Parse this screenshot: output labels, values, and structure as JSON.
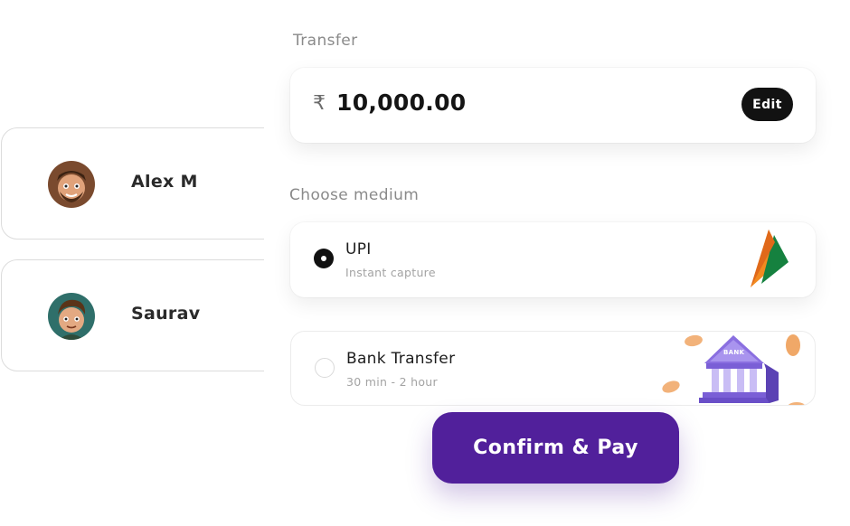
{
  "contacts": [
    {
      "name": "Alex M",
      "avatar_icon": "person-avatar-icon"
    },
    {
      "name": "Saurav",
      "avatar_icon": "person-avatar-icon"
    }
  ],
  "transfer": {
    "label": "Transfer",
    "currency_symbol": "₹",
    "amount": "10,000.00",
    "edit_label": "Edit"
  },
  "medium": {
    "label": "Choose medium",
    "options": [
      {
        "title": "UPI",
        "subtitle": "Instant capture",
        "selected": true,
        "icon": "upi-logo-icon"
      },
      {
        "title": "Bank Transfer",
        "subtitle": "30 min - 2 hour",
        "selected": false,
        "icon": "bank-building-icon",
        "icon_text": "BANK"
      }
    ]
  },
  "confirm_label": "Confirm & Pay",
  "colors": {
    "accent": "#51209b",
    "dark": "#121212",
    "upi_orange": "#f28a20",
    "upi_green": "#15813f",
    "bank_purple": "#8a6fe0"
  }
}
